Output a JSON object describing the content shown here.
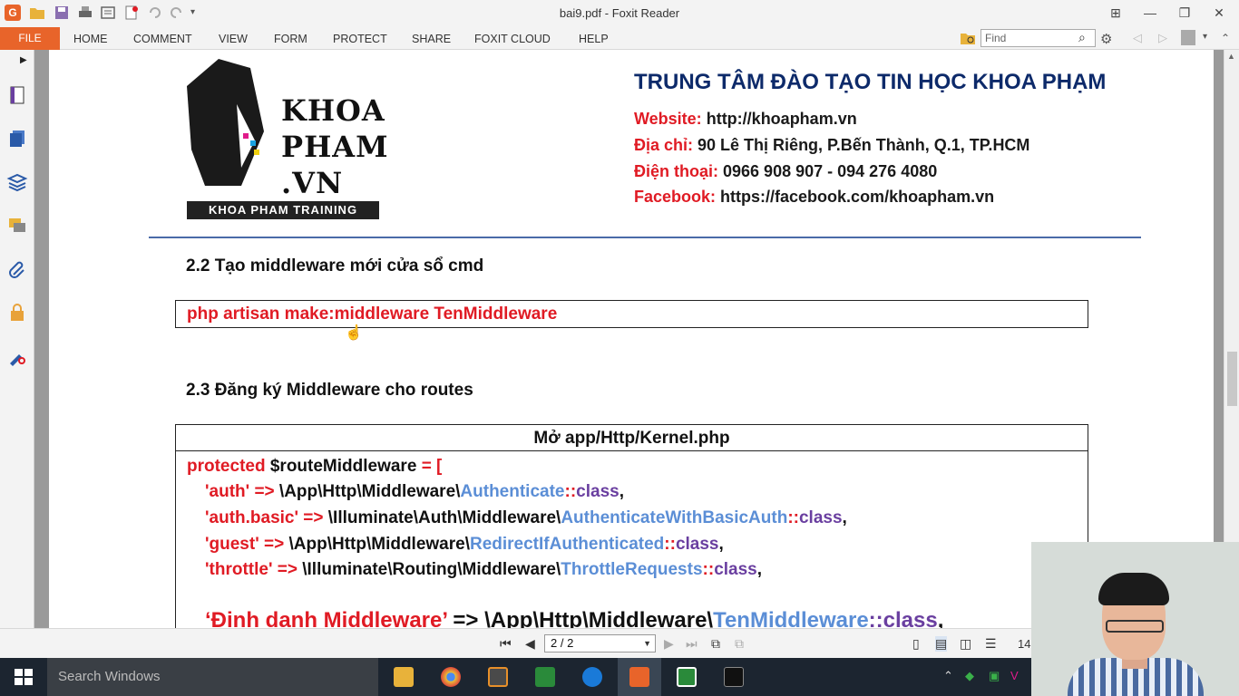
{
  "window": {
    "title": "bai9.pdf - Foxit Reader",
    "app_icon_letter": "G"
  },
  "ribbon": {
    "file": "FILE",
    "tabs": [
      "HOME",
      "COMMENT",
      "VIEW",
      "FORM",
      "PROTECT",
      "SHARE",
      "FOXIT CLOUD",
      "HELP"
    ],
    "find_placeholder": "Find"
  },
  "document": {
    "logo": {
      "lines": [
        "KHOA",
        "PHAM",
        ".VN"
      ],
      "band": "KHOA PHAM TRAINING"
    },
    "center_title": "TRUNG TÂM ĐÀO TẠO TIN HỌC KHOA PHẠM",
    "contact": {
      "website_label": "Website:",
      "website": "http://khoapham.vn",
      "address_label": "Địa chỉ:",
      "address": "90 Lê Thị Riêng, P.Bến Thành, Q.1, TP.HCM",
      "phone_label": "Điện thoại:",
      "phone": "0966 908 907 - 094 276 4080",
      "facebook_label": "Facebook:",
      "facebook": "https://facebook.com/khoapham.vn"
    },
    "section_2_2": {
      "heading": "2.2 Tạo middleware mới cửa sổ cmd",
      "command": "php artisan make:middleware TenMiddleware"
    },
    "section_2_3": {
      "heading": "2.3 Đăng ký Middleware cho routes",
      "box_title": "Mở app/Http/Kernel.php",
      "line0_kw": "protected",
      "line0_var": "$routeMiddleware",
      "line0_op": "= [",
      "entries": [
        {
          "key": "'auth'",
          "arrow": "=>",
          "ns": "\\App\\Http\\Middleware\\",
          "cls": "Authenticate",
          "sep": "::",
          "suffix": "class",
          "end": ","
        },
        {
          "key": "'auth.basic'",
          "arrow": "=>",
          "ns": "\\Illuminate\\Auth\\Middleware\\",
          "cls": "AuthenticateWithBasicAuth",
          "sep": "::",
          "suffix": "class",
          "end": ","
        },
        {
          "key": "'guest'",
          "arrow": "=>",
          "ns": "\\App\\Http\\Middleware\\",
          "cls": "RedirectIfAuthenticated",
          "sep": "::",
          "suffix": "class",
          "end": ","
        },
        {
          "key": "'throttle'",
          "arrow": "=>",
          "ns": "\\Illuminate\\Routing\\Middleware\\",
          "cls": "ThrottleRequests",
          "sep": "::",
          "suffix": "class",
          "end": ","
        }
      ],
      "custom": {
        "key": "‘Định danh Middleware’",
        "arrow": "=>",
        "ns": "\\App\\Http\\Middleware\\",
        "cls": "TenMiddleware",
        "sep": "::",
        "suffix": "class",
        "end": ","
      },
      "closing": "];"
    }
  },
  "navigation": {
    "page_display": "2 / 2",
    "zoom_partial": "14"
  },
  "taskbar": {
    "search_placeholder": "Search Windows"
  }
}
